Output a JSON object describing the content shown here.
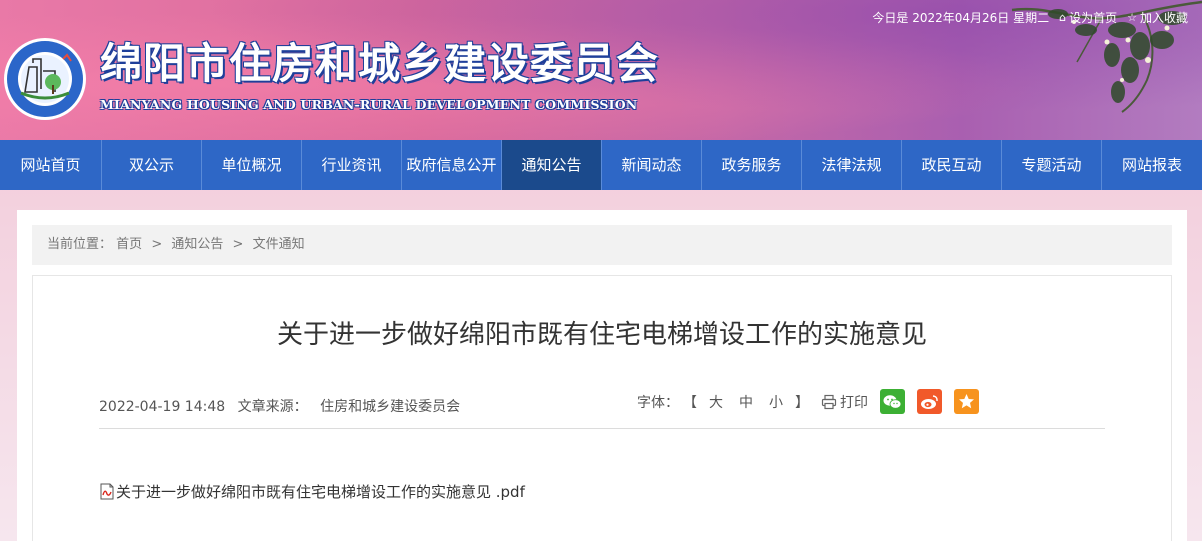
{
  "header": {
    "site_title": "绵阳市住房和城乡建设委员会",
    "site_subtitle": "MIANYANG HOUSING AND URBAN-RURAL DEVELOPMENT COMMISSION",
    "date_text": "今日是 2022年04月26日 星期二",
    "set_home_label": "设为首页",
    "bookmark_label": "加入收藏",
    "logo_text": "绵阳市住房和城乡建设委员会"
  },
  "nav": {
    "items": [
      {
        "label": "网站首页"
      },
      {
        "label": "双公示"
      },
      {
        "label": "单位概况"
      },
      {
        "label": "行业资讯"
      },
      {
        "label": "政府信息公开"
      },
      {
        "label": "通知公告"
      },
      {
        "label": "新闻动态"
      },
      {
        "label": "政务服务"
      },
      {
        "label": "法律法规"
      },
      {
        "label": "政民互动"
      },
      {
        "label": "专题活动"
      },
      {
        "label": "网站报表"
      }
    ],
    "active": "通知公告"
  },
  "breadcrumb": {
    "prefix": "当前位置：",
    "items": [
      "首页",
      "通知公告",
      "文件通知"
    ],
    "separator": ">"
  },
  "article": {
    "title": "关于进一步做好绵阳市既有住宅电梯增设工作的实施意见",
    "datetime": "2022-04-19 14:48",
    "source_label": "文章来源：",
    "source": "住房和城乡建设委员会",
    "font_label": "字体：",
    "bracket_open": "【",
    "bracket_close": "】",
    "font_sizes": [
      "大",
      "中",
      "小"
    ],
    "print_label": "打印",
    "attachment": "关于进一步做好绵阳市既有住宅电梯增设工作的实施意见 .pdf"
  },
  "colors": {
    "nav_bg": "#2e67c6",
    "nav_active": "#1b4a8c",
    "wechat": "#3cb034",
    "weibo": "#f1592a",
    "favorite": "#f7931e"
  }
}
